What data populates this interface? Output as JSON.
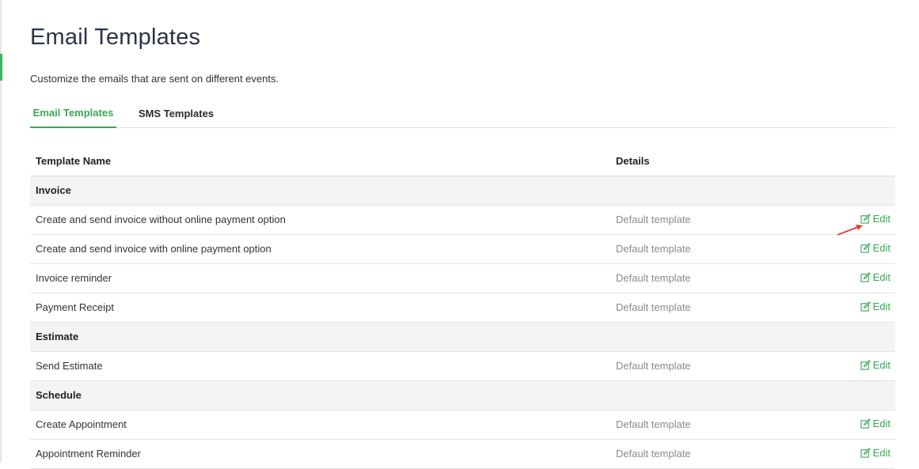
{
  "page": {
    "title": "Email Templates",
    "subtitle": "Customize the emails that are sent on different events."
  },
  "tabs": [
    {
      "label": "Email Templates",
      "active": true
    },
    {
      "label": "SMS Templates",
      "active": false
    }
  ],
  "table": {
    "headers": {
      "name": "Template Name",
      "details": "Details"
    },
    "groups": {
      "invoice": "Invoice",
      "estimate": "Estimate",
      "schedule": "Schedule"
    },
    "rows": [
      {
        "name": "Create and send invoice without online payment option",
        "details": "Default template",
        "action": "Edit"
      },
      {
        "name": "Create and send invoice with online payment option",
        "details": "Default template",
        "action": "Edit"
      },
      {
        "name": "Invoice reminder",
        "details": "Default template",
        "action": "Edit"
      },
      {
        "name": "Payment Receipt",
        "details": "Default template",
        "action": "Edit"
      },
      {
        "name": "Send Estimate",
        "details": "Default template",
        "action": "Edit"
      },
      {
        "name": "Create Appointment",
        "details": "Default template",
        "action": "Edit"
      },
      {
        "name": "Appointment Reminder",
        "details": "Default template",
        "action": "Edit"
      }
    ]
  },
  "colors": {
    "accent": "#3aa856",
    "title": "#2d3446",
    "group_bg": "#f4f4f4",
    "details_text": "#8a8a8a",
    "annotation_arrow": "#d9413a"
  },
  "icons": {
    "edit": "edit-square-pencil-icon"
  }
}
